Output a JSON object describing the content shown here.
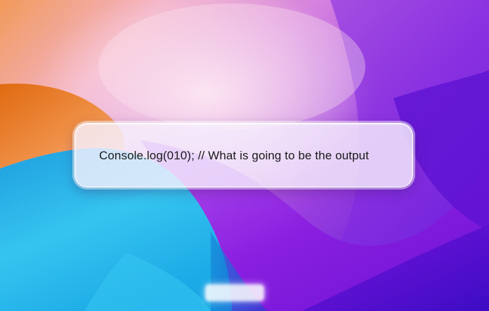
{
  "card": {
    "text": "Console.log(010); // What is going to be the output"
  },
  "colors": {
    "orange": "#e8731a",
    "cyan": "#2ab6ea",
    "purple": "#8a1fe0",
    "violet": "#5a0fd0",
    "card_bg": "#f7f0fc",
    "text": "#1a1a1a"
  }
}
